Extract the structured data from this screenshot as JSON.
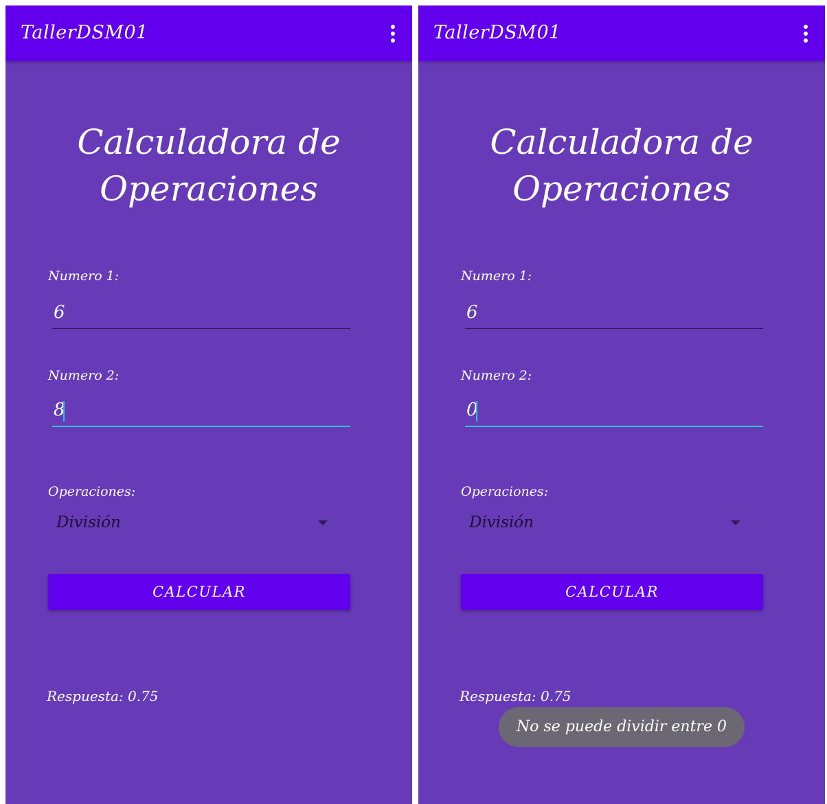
{
  "screens": [
    {
      "app_title": "TallerDSM01",
      "heading_line1": "Calculadora de",
      "heading_line2": "Operaciones",
      "numero1_label": "Numero 1:",
      "numero1_value": "6",
      "numero2_label": "Numero 2:",
      "numero2_value": "8",
      "operaciones_label": "Operaciones:",
      "operacion_selected": "División",
      "calcular_label": "CALCULAR",
      "respuesta_text": "Respuesta: 0.75"
    },
    {
      "app_title": "TallerDSM01",
      "heading_line1": "Calculadora de",
      "heading_line2": "Operaciones",
      "numero1_label": "Numero 1:",
      "numero1_value": "6",
      "numero2_label": "Numero 2:",
      "numero2_value": "0",
      "operaciones_label": "Operaciones:",
      "operacion_selected": "División",
      "calcular_label": "CALCULAR",
      "respuesta_text": "Respuesta: 0.75",
      "toast_text": "No se puede dividir entre 0"
    }
  ],
  "colors": {
    "app_bar": "#6200EE",
    "background": "#673AB7",
    "accent": "#26C6DA",
    "toast": "#6b6874"
  },
  "icons": {
    "overflow_menu": "more-vert-icon",
    "spinner_arrow": "arrow-drop-down-icon"
  }
}
